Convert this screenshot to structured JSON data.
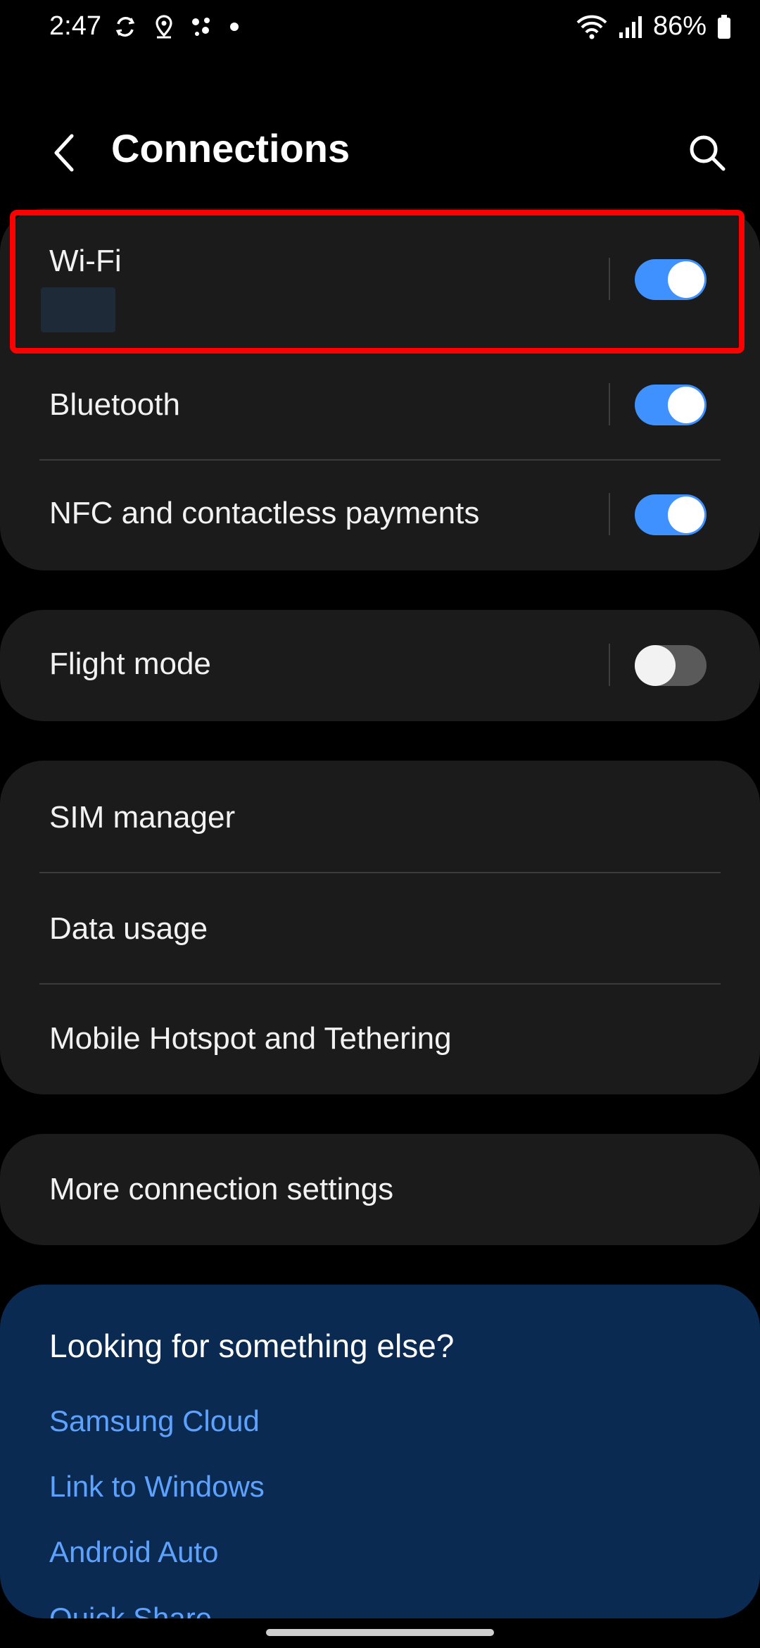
{
  "status": {
    "time": "2:47",
    "battery": "86%",
    "left_icons": [
      "sync-icon",
      "location-icon",
      "assistant-dots-icon",
      "dot-icon"
    ],
    "right_icons": [
      "wifi-icon",
      "signal-icon",
      "battery-icon"
    ]
  },
  "header": {
    "title": "Connections",
    "back_icon": "chevron-left-icon",
    "search_icon": "search-icon"
  },
  "group1": {
    "wifi": {
      "label": "Wi-Fi",
      "enabled": true
    },
    "bluetooth": {
      "label": "Bluetooth",
      "enabled": true
    },
    "nfc": {
      "label": "NFC and contactless payments",
      "enabled": true
    }
  },
  "group2": {
    "flight": {
      "label": "Flight mode",
      "enabled": false
    }
  },
  "group3": {
    "items": [
      "SIM manager",
      "Data usage",
      "Mobile Hotspot and Tethering"
    ]
  },
  "group4": {
    "more": "More connection settings"
  },
  "suggestions": {
    "title": "Looking for something else?",
    "links": [
      "Samsung Cloud",
      "Link to Windows",
      "Android Auto",
      "Quick Share"
    ]
  },
  "colors": {
    "accent": "#3e91ff",
    "card": "#1b1b1b",
    "link": "#5ea2ff",
    "highlight": "#ff0000"
  }
}
